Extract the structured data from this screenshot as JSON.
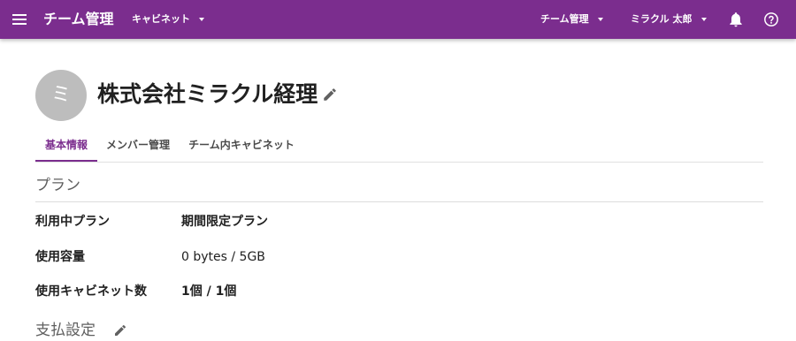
{
  "appbar": {
    "title": "チーム管理",
    "cabinet_menu": "キャビネット",
    "team_menu": "チーム管理",
    "user_menu": "ミラクル 太郎",
    "bg_color": "#7b2d8e"
  },
  "header": {
    "avatar_initial": "ミ",
    "team_name": "株式会社ミラクル経理"
  },
  "tabs": [
    {
      "label": "基本情報",
      "active": true
    },
    {
      "label": "メンバー管理",
      "active": false
    },
    {
      "label": "チーム内キャビネット",
      "active": false
    }
  ],
  "plan_section": {
    "title": "プラン",
    "rows": [
      {
        "label": "利用中プラン",
        "value": "期間限定プラン"
      },
      {
        "label": "使用容量",
        "value": "0 bytes / 5GB"
      },
      {
        "label": "使用キャビネット数",
        "value": "1個 / 1個"
      }
    ]
  },
  "payment_section": {
    "title": "支払設定"
  },
  "icons": {
    "menu": "hamburger-icon",
    "edit": "pencil-icon",
    "notifications": "bell-icon",
    "help": "help-circle-icon",
    "dropdown": "caret-down-icon"
  }
}
